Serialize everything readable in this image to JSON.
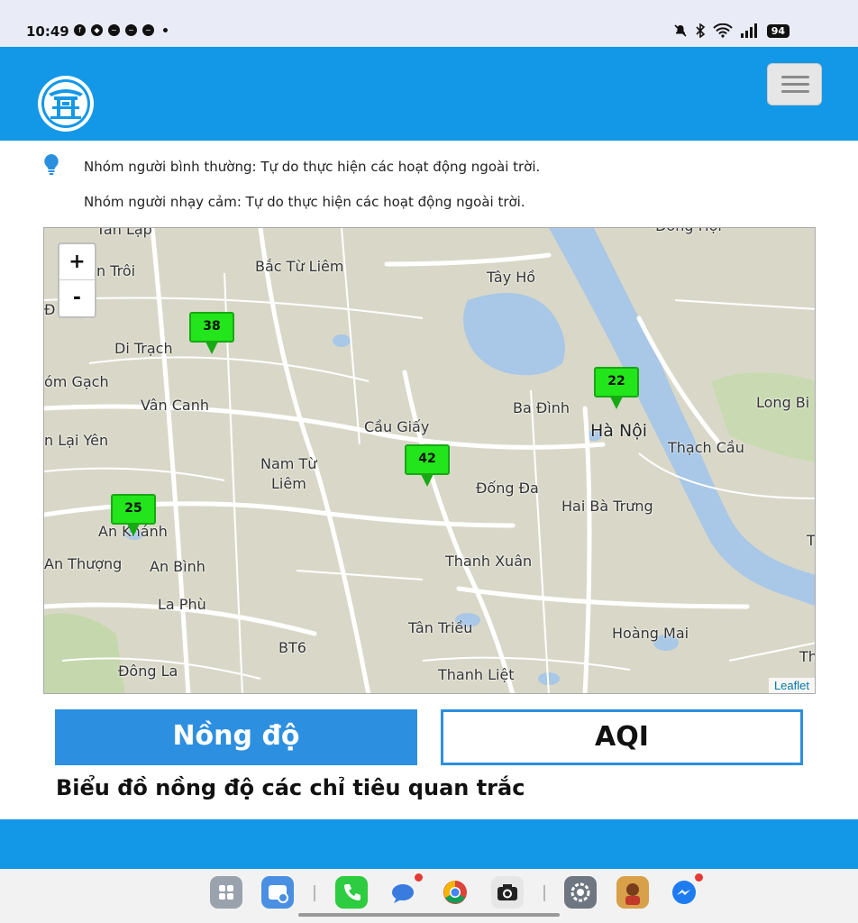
{
  "status_bar": {
    "time": "10:49",
    "battery": "94"
  },
  "advice": {
    "line1": "Nhóm người bình thường: Tự do thực hiện các hoạt động ngoài trời.",
    "line2": "Nhóm người nhạy cảm: Tự do thực hiện các hoạt động ngoài trời."
  },
  "map": {
    "zoom_in": "+",
    "zoom_out": "-",
    "attribution": "Leaflet",
    "labels": {
      "tan_lap": "Tân Lập",
      "an_troi": "n Trôi",
      "bac_tu_liem": "Bắc Từ Liêm",
      "tay_ho": "Tây Hồ",
      "dong_hoi": "Đông Hội",
      "giang": "Đ   iang",
      "di_trach": "Di Trạch",
      "om_gach": "óm Gạch",
      "van_canh": "Vân Canh",
      "cau_giay": "Cầu Giấy",
      "ba_dinh": "Ba Đình",
      "ha_noi": "Hà Nội",
      "long_bien": "Long Bi",
      "lai_yen": "n  Lại Yên",
      "thach_cau": "Thạch Cầu",
      "nam_tu_liem_1": "Nam Từ",
      "nam_tu_liem_2": "Liêm",
      "dong_da": "Đống Đa",
      "hai_ba_trung": "Hai Bà Trưng",
      "an_khanh": "An Khánh",
      "an_thuong": "An Thượng",
      "an_binh": "An Bình",
      "thanh_xuan": "Thanh Xuân",
      "la_phu": "La Phù",
      "tan_trieu": "Tân Triều",
      "hoang_mai": "Hoàng Mai",
      "bt6": "BT6",
      "dong_la": "Đông La",
      "thanh_liet": "Thanh Liệt",
      "th": "Th",
      "t": "T"
    },
    "markers": [
      {
        "value": "38"
      },
      {
        "value": "22"
      },
      {
        "value": "42"
      },
      {
        "value": "25"
      }
    ],
    "colors": {
      "marker_fill": "#22e51b",
      "water": "#a9c7e6",
      "land": "#d9d8c8"
    }
  },
  "tabs": {
    "concentration": "Nồng độ",
    "aqi": "AQI"
  },
  "section": {
    "title": "Biểu đồ nồng độ các chỉ tiêu quan trắc"
  },
  "colors": {
    "brand_blue": "#1398e8",
    "tab_blue": "#2d8fe0"
  }
}
